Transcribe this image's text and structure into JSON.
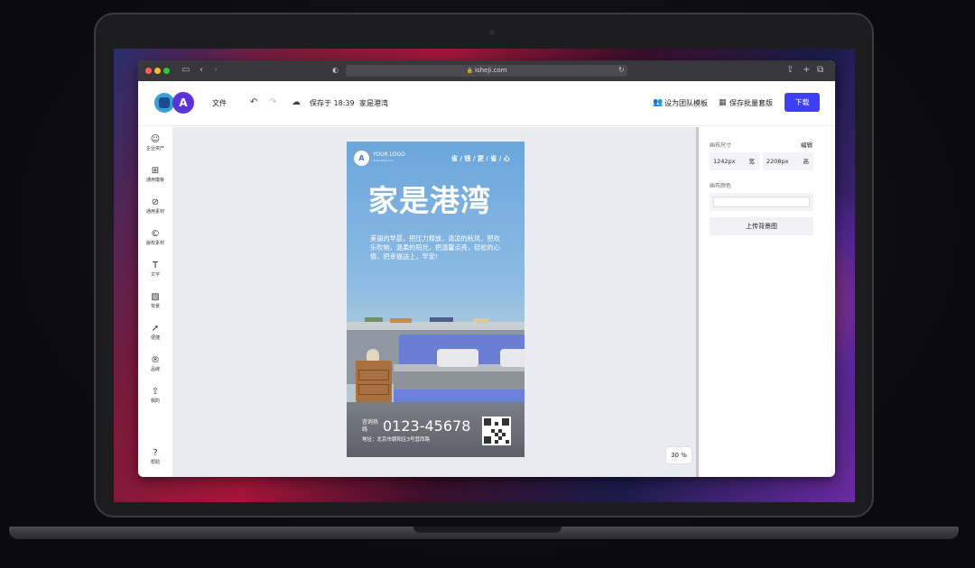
{
  "browser": {
    "url": "isheji.com"
  },
  "header": {
    "file_menu": "文件",
    "saved_status": "保存于 18:39",
    "doc_title": "家是港湾",
    "team_template": "设为团队模板",
    "batch_save": "保存批量套版",
    "download": "下载"
  },
  "sidebar": {
    "items": [
      {
        "label": "企业资产",
        "icon": "users-icon"
      },
      {
        "label": "通用模板",
        "icon": "template-icon"
      },
      {
        "label": "通用素材",
        "icon": "material-icon"
      },
      {
        "label": "版权素材",
        "icon": "copyright-icon"
      },
      {
        "label": "文字",
        "icon": "text-icon"
      },
      {
        "label": "背景",
        "icon": "background-icon"
      },
      {
        "label": "便捷",
        "icon": "send-icon"
      },
      {
        "label": "品牌",
        "icon": "brand-icon"
      },
      {
        "label": "我的",
        "icon": "upload-icon"
      }
    ],
    "help": "帮助"
  },
  "poster": {
    "logo_text": "YOUR LOGO",
    "logo_sub": "www.isheji.com",
    "slogan": "省 / 钱 / 更 / 省 / 心",
    "title": "家是港湾",
    "body": "美丽的早晨，把压力释放，清凉的秋风，把欢乐吹响，温柔的阳光，把温馨点亮，轻松的心情，把幸福送上，早安!",
    "contact_label": "咨询热线",
    "phone": "0123-45678",
    "address": "地址：北京市朝阳区3号营西路"
  },
  "zoom": "30 %",
  "panel": {
    "size_label": "画布尺寸",
    "edit": "编辑",
    "width_value": "1242px",
    "width_unit": "宽",
    "height_value": "2208px",
    "height_unit": "高",
    "color_label": "画布颜色",
    "upload_bg": "上传背景图"
  },
  "colors": {
    "accent": "#3d3ef5",
    "poster_sky": "#6aa6dc",
    "bed": "#6b80d8"
  }
}
